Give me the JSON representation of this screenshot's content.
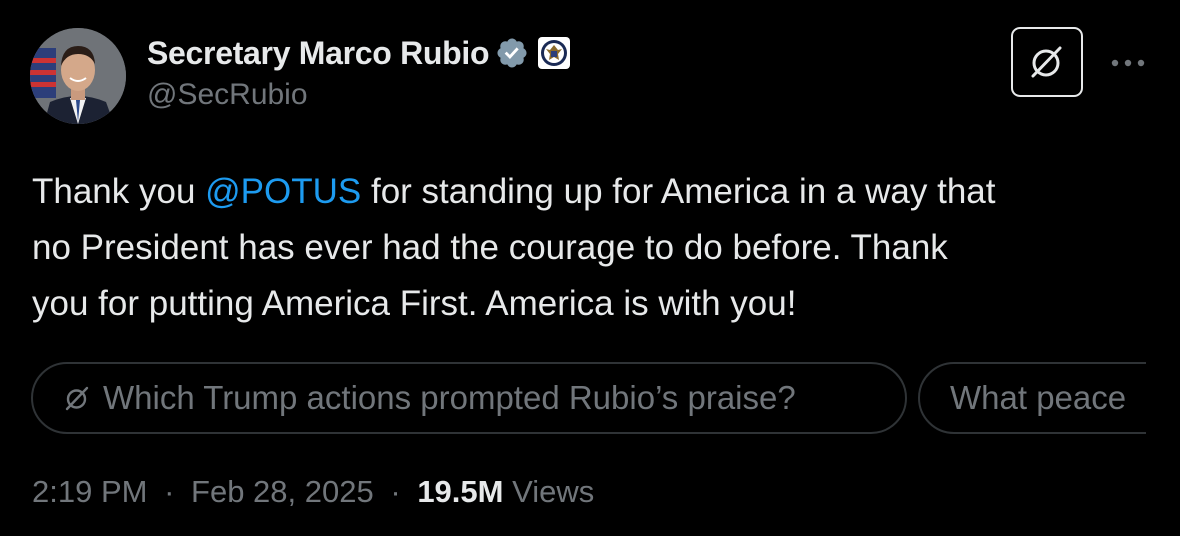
{
  "author": {
    "name": "Secretary Marco Rubio",
    "handle": "@SecRubio",
    "verified_icon": "verified-badge-icon",
    "affiliation_icon": "state-department-seal-icon"
  },
  "header": {
    "grok_icon": "grok-icon",
    "more_icon": "more-options-icon"
  },
  "tweet": {
    "line1_before": "Thank you ",
    "mention": "@POTUS",
    "line1_after": " for standing up for America in a way that",
    "line2": "no President has ever had the courage to do before. Thank",
    "line3": "you for putting America First. America is with you!"
  },
  "grok_suggestions": [
    "Which Trump actions prompted Rubio’s praise?",
    "What peace"
  ],
  "meta": {
    "time": "2:19 PM",
    "separator": "·",
    "date": "Feb 28, 2025",
    "views_count": "19.5M",
    "views_label": "Views"
  },
  "colors": {
    "background": "#000000",
    "text": "#e7e9ea",
    "secondary": "#71767b",
    "link": "#1d9bf0",
    "border": "#2f3336",
    "verified": "#829aab"
  }
}
